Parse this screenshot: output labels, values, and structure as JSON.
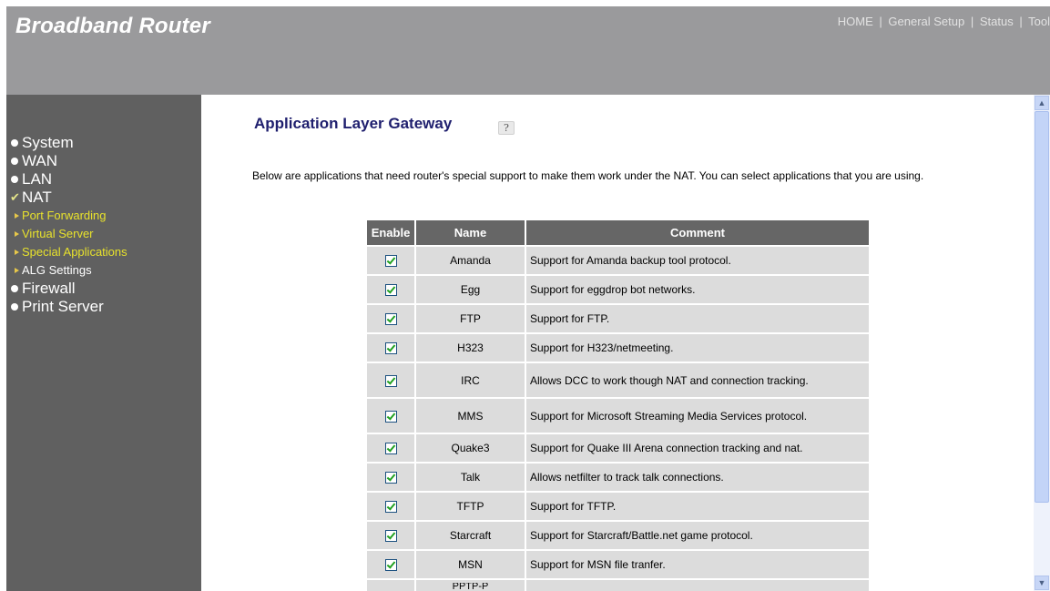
{
  "header": {
    "brand": "Broadband Router",
    "nav": [
      "HOME",
      "General Setup",
      "Status",
      "Tool"
    ],
    "separator": "|"
  },
  "sidebar": {
    "items": [
      {
        "label": "System",
        "marker": "bullet"
      },
      {
        "label": "WAN",
        "marker": "bullet"
      },
      {
        "label": "LAN",
        "marker": "bullet"
      },
      {
        "label": "NAT",
        "marker": "check"
      },
      {
        "label": "Firewall",
        "marker": "bullet"
      },
      {
        "label": "Print Server",
        "marker": "bullet"
      }
    ],
    "nat_subitems": [
      "Port Forwarding",
      "Virtual Server",
      "Special Applications",
      "ALG Settings"
    ],
    "active_subitem": "ALG Settings"
  },
  "main": {
    "title": "Application Layer Gateway",
    "help_glyph": "?",
    "description": "Below are applications that need router's special support to make them work under the NAT. You can select applications that you are using.",
    "table": {
      "headers": [
        "Enable",
        "Name",
        "Comment"
      ],
      "rows": [
        {
          "enabled": true,
          "name": "Amanda",
          "comment": "Support for Amanda backup tool protocol."
        },
        {
          "enabled": true,
          "name": "Egg",
          "comment": "Support for eggdrop bot networks."
        },
        {
          "enabled": true,
          "name": "FTP",
          "comment": "Support for FTP."
        },
        {
          "enabled": true,
          "name": "H323",
          "comment": "Support for H323/netmeeting."
        },
        {
          "enabled": true,
          "name": "IRC",
          "comment": "Allows DCC to work though NAT and connection tracking."
        },
        {
          "enabled": true,
          "name": "MMS",
          "comment": "Support for Microsoft Streaming Media Services protocol."
        },
        {
          "enabled": true,
          "name": "Quake3",
          "comment": "Support for Quake III Arena connection tracking and nat."
        },
        {
          "enabled": true,
          "name": "Talk",
          "comment": "Allows netfilter to track talk connections."
        },
        {
          "enabled": true,
          "name": "TFTP",
          "comment": "Support for TFTP."
        },
        {
          "enabled": true,
          "name": "Starcraft",
          "comment": "Support for Starcraft/Battle.net game protocol."
        },
        {
          "enabled": true,
          "name": "MSN",
          "comment": "Support for MSN file tranfer."
        },
        {
          "enabled": true,
          "name": "PPTP-P",
          "comment": ""
        }
      ]
    }
  },
  "colors": {
    "header_bg": "#9a9a9c",
    "sidebar_bg": "#606060",
    "submenu_text": "#e8e22c",
    "title_text": "#1f1f6e",
    "table_header_bg": "#666666",
    "table_cell_bg": "#dcdcdc"
  },
  "icons": {
    "help": "help-icon",
    "checkbox": "checkbox-checked-icon",
    "scroll_up": "chevron-up-icon",
    "scroll_down": "chevron-down-icon"
  }
}
